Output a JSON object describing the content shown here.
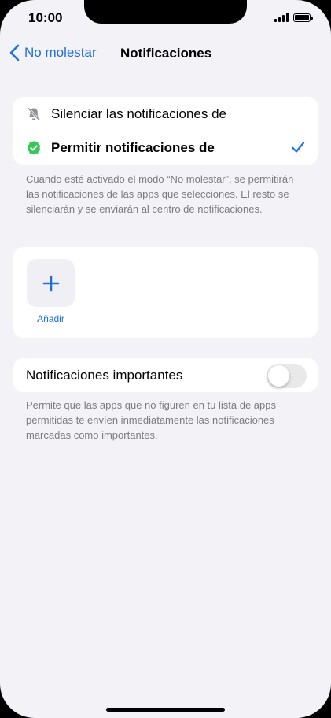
{
  "status_bar": {
    "time": "10:00"
  },
  "nav": {
    "back_label": "No molestar",
    "title": "Notificaciones"
  },
  "options": {
    "items": [
      {
        "label": "Silenciar las notificaciones de",
        "icon": "bell-slash-icon",
        "selected": false
      },
      {
        "label": "Permitir notificaciones de",
        "icon": "verified-badge-icon",
        "selected": true
      }
    ],
    "footnote": "Cuando esté activado el modo “No molestar”, se permitirán las notificaciones de las apps que selecciones. El resto se silenciarán y se enviarán al centro de notificaciones."
  },
  "apps": {
    "add_label": "Añadir"
  },
  "important": {
    "label": "Notificaciones importantes",
    "enabled": false,
    "footnote": "Permite que las apps que no figuren en tu lista de apps permitidas te envíen inmediatamente las notificaciones marcadas como importantes."
  },
  "colors": {
    "accent": "#1f6fe0",
    "badge_green": "#34c759",
    "background": "#f2f2f7"
  }
}
